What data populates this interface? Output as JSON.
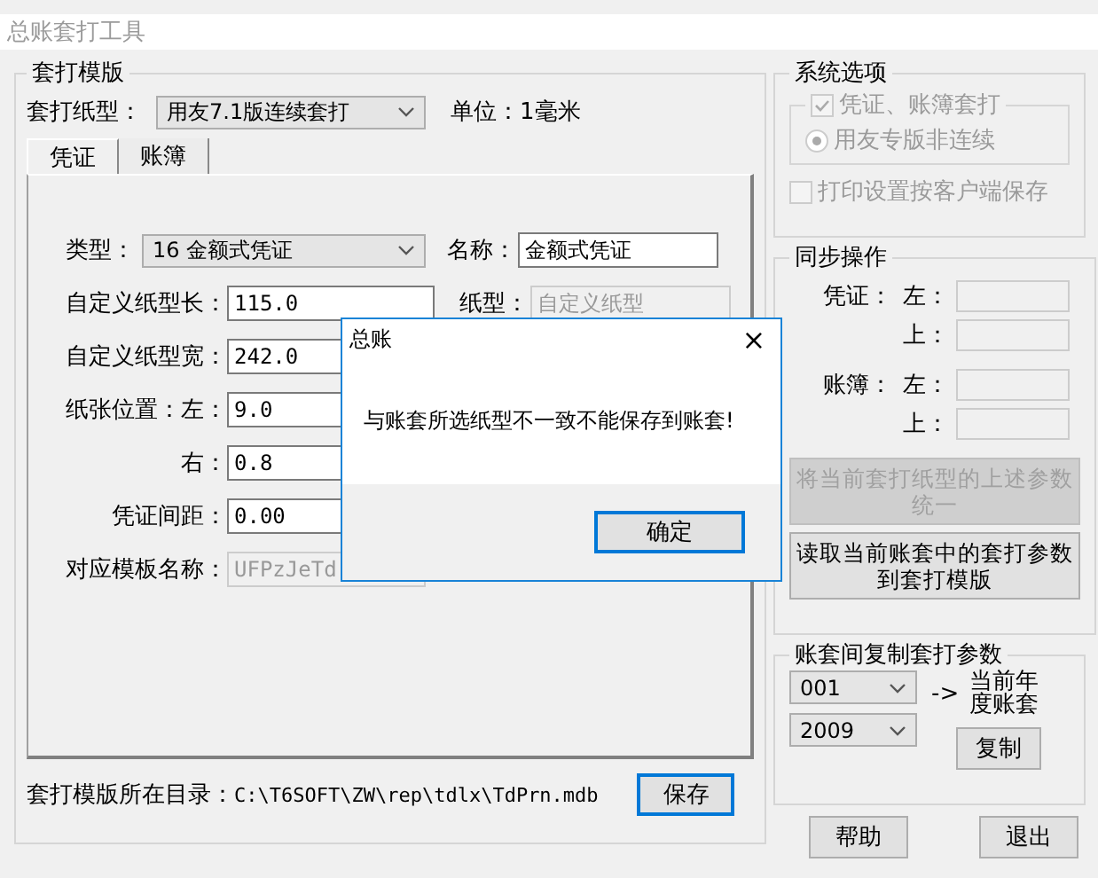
{
  "window": {
    "title": "总账套打工具"
  },
  "template_group": {
    "title": "套打模版",
    "paper_type_label": "套打纸型：",
    "paper_type_value": "用友7.1版连续套打",
    "unit_label": "单位：1毫米",
    "tabs": [
      {
        "label": "凭证",
        "selected": true
      },
      {
        "label": "账簿",
        "selected": false
      }
    ],
    "form_rows": [
      {
        "label": "类型：",
        "kind": "select",
        "value": "16 金额式凭证",
        "side": {
          "label": "名称：",
          "kind": "input",
          "value": "金额式凭证"
        }
      },
      {
        "label": "自定义纸型长：",
        "kind": "input",
        "value": "115.0",
        "side": {
          "label": "纸型：",
          "kind": "readonly",
          "value": "自定义纸型"
        }
      },
      {
        "label": "自定义纸型宽：",
        "kind": "input",
        "value": "242.0"
      },
      {
        "label": "纸张位置：左：",
        "kind": "input",
        "value": "9.0"
      },
      {
        "label": "右：",
        "kind": "input",
        "value": "0.8"
      },
      {
        "label": "凭证间距：",
        "kind": "input",
        "value": "0.00"
      },
      {
        "label": "对应模板名称：",
        "kind": "readonly",
        "value": "UFPzJeTd"
      }
    ],
    "path_label": "套打模版所在目录：",
    "path": "C:\\T6SOFT\\ZW\\rep\\tdlx\\TdPrn.mdb",
    "save_button": "保存"
  },
  "system_options": {
    "title": "系统选项",
    "print_check": {
      "label": "凭证、账簿套打",
      "checked": true,
      "disabled": true
    },
    "radio": {
      "label": "用友专版非连续",
      "selected": true,
      "disabled": true
    },
    "client_save": {
      "label": "打印设置按客户端保存",
      "checked": false,
      "disabled": true
    }
  },
  "sync": {
    "title": "同步操作",
    "groups": [
      {
        "label": "凭证：",
        "fields": [
          {
            "label": "左："
          },
          {
            "label": "上："
          }
        ]
      },
      {
        "label": "账簿：",
        "fields": [
          {
            "label": "左："
          },
          {
            "label": "上："
          }
        ]
      }
    ],
    "buttons": [
      {
        "label": "将当前套打纸型的上述参数统一",
        "disabled": true
      },
      {
        "label": "读取当前账套中的套打参数到套打模版",
        "disabled": false
      }
    ]
  },
  "copy": {
    "title": "账套间复制套打参数",
    "account": "001",
    "year": "2009",
    "arrow": "->",
    "target": "当前年度账套",
    "button": "复制"
  },
  "footer_buttons": [
    "帮助",
    "退出"
  ],
  "dialog": {
    "title": "总账",
    "close": "×",
    "message": "与账套所选纸型不一致不能保存到账套!",
    "button": "确定"
  }
}
